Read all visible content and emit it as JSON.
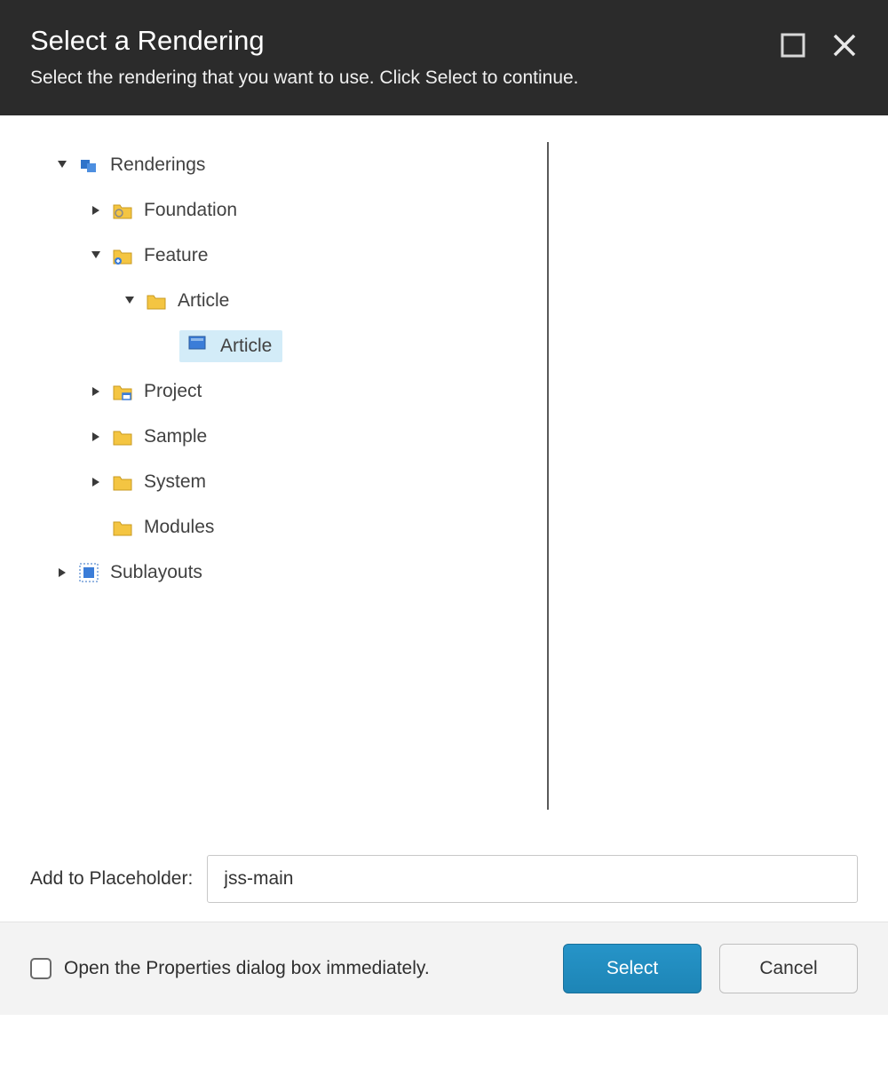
{
  "header": {
    "title": "Select a Rendering",
    "subtitle": "Select the rendering that you want to use. Click Select to continue."
  },
  "tree": {
    "renderings_label": "Renderings",
    "foundation_label": "Foundation",
    "feature_label": "Feature",
    "article_folder_label": "Article",
    "article_item_label": "Article",
    "project_label": "Project",
    "sample_label": "Sample",
    "system_label": "System",
    "modules_label": "Modules",
    "sublayouts_label": "Sublayouts"
  },
  "placeholder": {
    "label": "Add to Placeholder:",
    "value": "jss-main"
  },
  "footer": {
    "open_properties_label": "Open the Properties dialog box immediately.",
    "select_label": "Select",
    "cancel_label": "Cancel"
  }
}
